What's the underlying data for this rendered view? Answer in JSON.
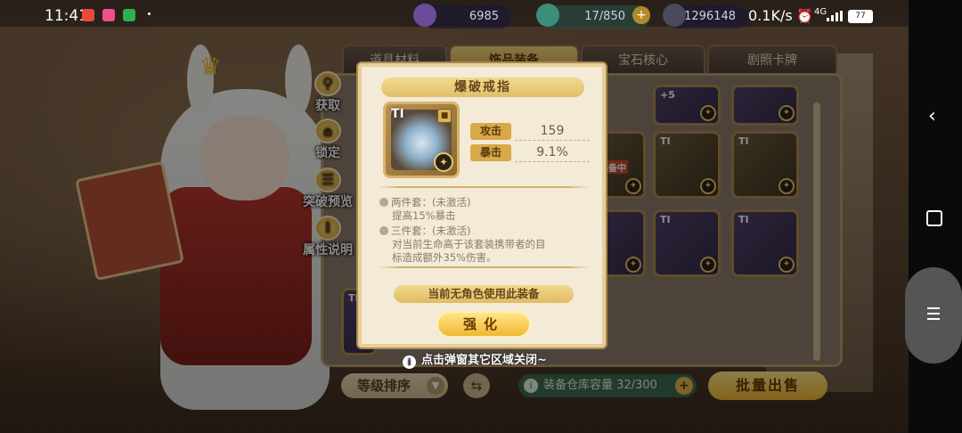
{
  "status_bar": {
    "time": "11:41",
    "net_speed": "0.1K/s",
    "network_type": "4G",
    "battery": "77"
  },
  "top_bar": {
    "gems": "6985",
    "stamina": "17/850",
    "coins": "1296148"
  },
  "tabs": [
    {
      "label": "道具材料"
    },
    {
      "label": "饰品装备"
    },
    {
      "label": "宝石核心"
    },
    {
      "label": "剧照卡牌"
    }
  ],
  "side_buttons": {
    "obtain": "获取",
    "lock": "锁定",
    "breakthrough_preview": "突破预览",
    "attribute_info": "属性说明"
  },
  "grid_tiers": [
    "TI",
    "TI",
    "TI",
    "TI",
    "TI",
    "TI",
    "TI"
  ],
  "grid_badge": "装备中",
  "grid_plus_label": "+5",
  "modal": {
    "title": "爆破戒指",
    "item_tier": "TI",
    "stats": [
      {
        "label": "攻击",
        "value": "159"
      },
      {
        "label": "暴击",
        "value": "9.1%"
      }
    ],
    "set_two_head": "两件套：(未激活)",
    "set_two_desc": "提高15%暴击",
    "set_three_head": "三件套：(未激活)",
    "set_three_desc_1": "对当前生命高于该套装携带者的目",
    "set_three_desc_2": "标造成额外35%伤害。",
    "no_user_note": "当前无角色使用此装备",
    "enhance_button": "强化"
  },
  "close_hint": "点击弹窗其它区域关闭~",
  "bottom": {
    "sort_label": "等级排序",
    "capacity_label": "装备仓库容量 32/300",
    "bulk_sell": "批量出售"
  }
}
